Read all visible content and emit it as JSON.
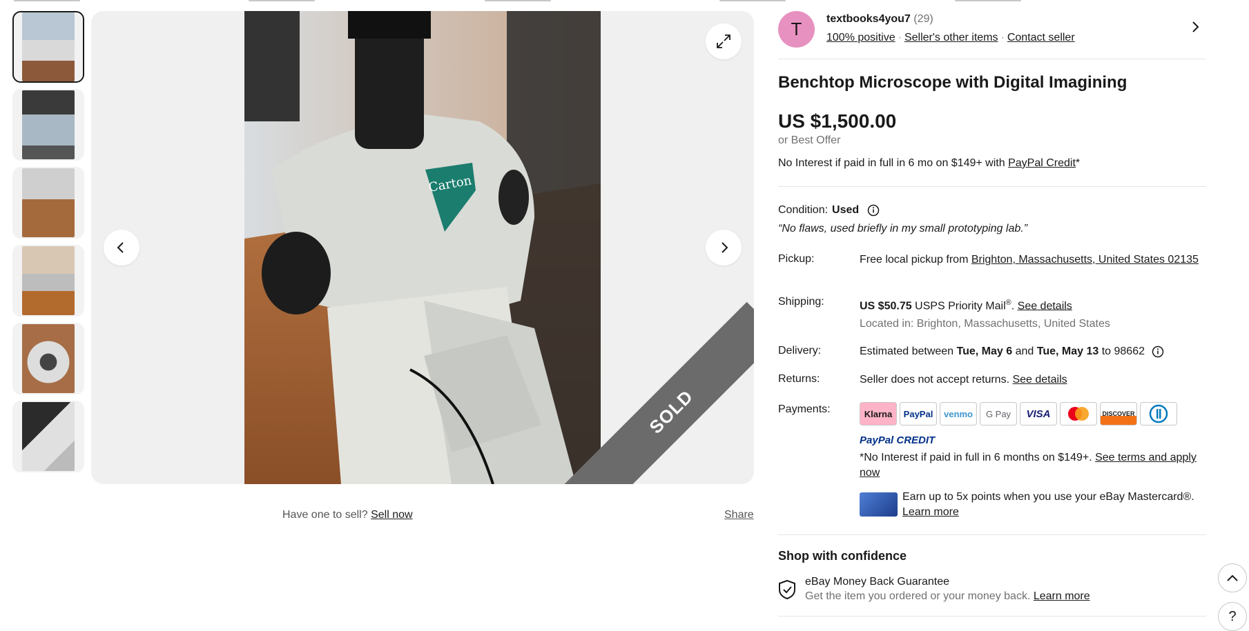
{
  "seller": {
    "initial": "T",
    "name": "textbooks4you7",
    "feedback_count": "(29)",
    "positive": "100% positive",
    "other_items": "Seller's other items",
    "contact": "Contact seller"
  },
  "item": {
    "title": "Benchtop Microscope with Digital Imagining",
    "price": "US $1,500.00",
    "best_offer": "or Best Offer",
    "no_interest_prefix": "No Interest if paid in full in 6 mo on $149+ with ",
    "paypal_credit_link": "PayPal Credit",
    "no_interest_suffix": "*"
  },
  "image": {
    "sold_label": "SOLD",
    "have_one": "Have one to sell?",
    "sell_now": "Sell now",
    "share": "Share"
  },
  "condition": {
    "label": "Condition:",
    "value": "Used",
    "quote": "“No flaws, used briefly in my small prototyping lab.”"
  },
  "pickup": {
    "label": "Pickup:",
    "text": "Free local pickup from ",
    "location_link": "Brighton, Massachusetts, United States 02135"
  },
  "shipping": {
    "label": "Shipping:",
    "cost": "US $50.75",
    "service": " USPS Priority Mail",
    "reg": "®",
    "sep": ". ",
    "details_link": "See details",
    "located": "Located in: Brighton, Massachusetts, United States"
  },
  "delivery": {
    "label": "Delivery:",
    "prefix": "Estimated between ",
    "date1": "Tue, May 6",
    "and": " and ",
    "date2": "Tue, May 13",
    "suffix": " to 98662"
  },
  "returns": {
    "label": "Returns:",
    "text": "Seller does not accept returns. ",
    "details_link": "See details"
  },
  "payments": {
    "label": "Payments:",
    "methods": [
      "Klarna",
      "PayPal",
      "venmo",
      "G Pay",
      "VISA",
      "Mastercard",
      "DISCOVER",
      "Diners"
    ],
    "paypal_credit": "PayPal CREDIT",
    "terms_text": "*No Interest if paid in full in 6 months on $149+. ",
    "terms_link": "See terms and apply now",
    "card_text": "Earn up to 5x points when you use your eBay Mastercard®.",
    "card_learn_more": "Learn more"
  },
  "confidence": {
    "title": "Shop with confidence",
    "guarantee_title": "eBay Money Back Guarantee",
    "guarantee_text": "Get the item you ordered or your money back. ",
    "learn_more": "Learn more"
  },
  "colors": {
    "avatar": "#e791c0",
    "klarna": "#ffb3c7",
    "paypal_blue": "#003087",
    "sold_ribbon": "#6b6b6b"
  }
}
